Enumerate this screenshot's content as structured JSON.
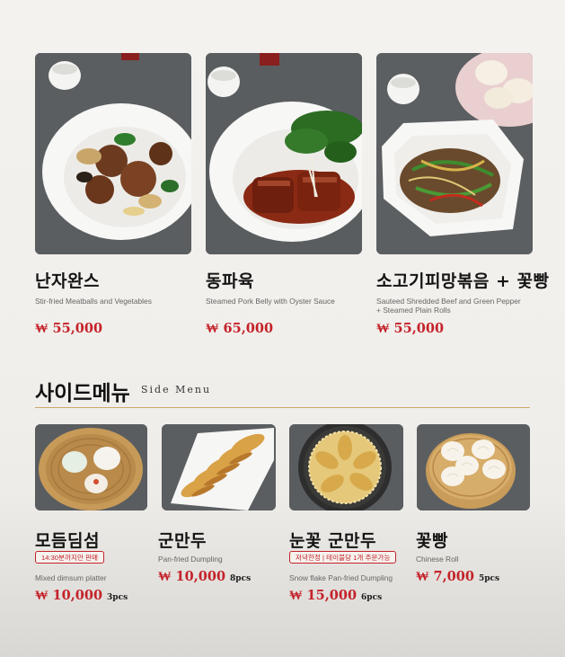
{
  "main_items": [
    {
      "name_ko": "난자완스",
      "name_en": "Stir-fried Meatballs and Vegetables",
      "name_en2": "",
      "price": "₩ 55,000",
      "photo_icon": "meatball-dish-icon"
    },
    {
      "name_ko": "동파육",
      "name_en": "Steamed Pork Belly with Oyster Sauce",
      "name_en2": "",
      "price": "₩ 65,000",
      "photo_icon": "pork-belly-dish-icon"
    },
    {
      "name_ko": "소고기피망볶음 + 꽃빵",
      "name_en": "Sauteed Shredded Beef and Green Pepper",
      "name_en2": "+ Steamed Plain Rolls",
      "price": "₩ 55,000",
      "photo_icon": "beef-pepper-dish-icon"
    }
  ],
  "side_section": {
    "title": "사이드메뉴",
    "subtitle": "Side Menu"
  },
  "side_items": [
    {
      "name_ko": "모듬딤섬",
      "badge": "14:30분까지만 판매",
      "name_en": "Mixed dimsum platter",
      "price": "₩ 10,000",
      "qty": "3pcs",
      "photo_icon": "dimsum-basket-icon"
    },
    {
      "name_ko": "군만두",
      "badge": "",
      "name_en": "Pan-fried Dumpling",
      "price": "₩ 10,000",
      "qty": "8pcs",
      "photo_icon": "fried-dumpling-icon"
    },
    {
      "name_ko": "눈꽃 군만두",
      "badge": "저녁한정 | 테이블당 1개 주문가능",
      "name_en": "Snow flake Pan-fried Dumpling",
      "price": "₩ 15,000",
      "qty": "6pcs",
      "photo_icon": "snowflake-dumpling-icon"
    },
    {
      "name_ko": "꽃빵",
      "badge": "",
      "name_en": "Chinese Roll",
      "price": "₩ 7,000",
      "qty": "5pcs",
      "photo_icon": "chinese-roll-icon"
    }
  ],
  "colors": {
    "price": "#c4222a",
    "divider": "#c9a86a",
    "photo_bg": "#5a5d60"
  }
}
